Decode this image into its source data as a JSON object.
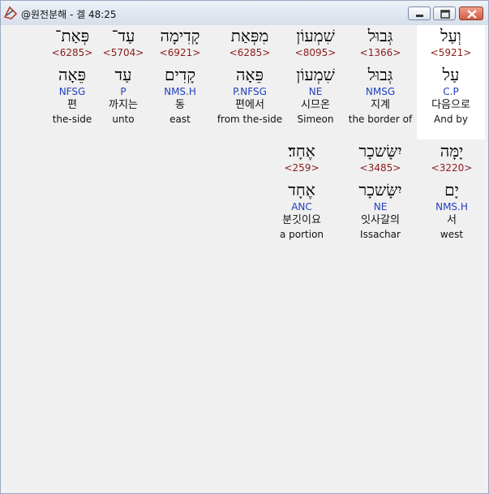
{
  "window": {
    "title": "@원전분해 - 겔 48:25",
    "buttons": [
      "minimize",
      "maximize",
      "close"
    ]
  },
  "rows": [
    {
      "words": [
        {
          "hebrew": "וְעַל",
          "strong": "<5921>",
          "lemma": "עַל",
          "morph": "C.P",
          "korean": "다음으로",
          "english": "And by",
          "selected": true
        },
        {
          "hebrew": "גְּבוּל",
          "strong": "<1366>",
          "lemma": "גְּבוּל",
          "morph": "NMSG",
          "korean": "지계",
          "english": "the border of",
          "selected": false
        },
        {
          "hebrew": "שִׁמְעוֹן",
          "strong": "<8095>",
          "lemma": "שִׁמְעוֹן",
          "morph": "NE",
          "korean": "시므온",
          "english": "Simeon",
          "selected": false
        },
        {
          "hebrew": "מִפְּאַת",
          "strong": "<6285>",
          "lemma": "פֵּאָה",
          "morph": "P.NFSG",
          "korean": "편에서",
          "english": "from the-side",
          "selected": false
        },
        {
          "hebrew": "קָדִימָה",
          "strong": "<6921>",
          "lemma": "קָדִים",
          "morph": "NMS.H",
          "korean": "동",
          "english": "east",
          "selected": false
        },
        {
          "hebrew": "עַד־",
          "strong": "<5704>",
          "lemma": "עַד",
          "morph": "P",
          "korean": "까지는",
          "english": "unto",
          "selected": false
        },
        {
          "hebrew": "פְּאַת־",
          "strong": "<6285>",
          "lemma": "פֵּאָה",
          "morph": "NFSG",
          "korean": "편",
          "english": "the-side",
          "selected": false
        }
      ]
    },
    {
      "words": [
        {
          "hebrew": "יָמָּה",
          "strong": "<3220>",
          "lemma": "יָם",
          "morph": "NMS.H",
          "korean": "서",
          "english": "west",
          "selected": false
        },
        {
          "hebrew": "יִשָּׂשכָר",
          "strong": "<3485>",
          "lemma": "יִשָּׂשכָר",
          "morph": "NE",
          "korean": "잇사갈의",
          "english": "Issachar",
          "selected": false
        },
        {
          "hebrew": "אֶחָד׃",
          "strong": "<259>",
          "lemma": "אֶחָד",
          "morph": "ANC",
          "korean": "분깃이요",
          "english": "a portion",
          "selected": false
        }
      ]
    }
  ]
}
